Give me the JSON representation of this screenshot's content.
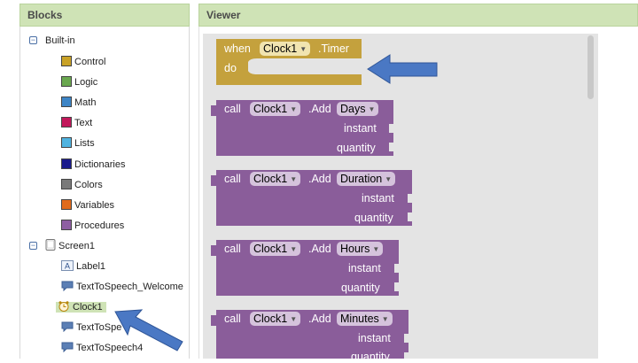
{
  "panels": {
    "blocks_title": "Blocks",
    "viewer_title": "Viewer"
  },
  "tree": {
    "builtin": {
      "label": "Built-in",
      "items": [
        {
          "label": "Control",
          "color": "#c9a227"
        },
        {
          "label": "Logic",
          "color": "#6aa84f"
        },
        {
          "label": "Math",
          "color": "#3d85c6"
        },
        {
          "label": "Text",
          "color": "#c2185b"
        },
        {
          "label": "Lists",
          "color": "#4fb3e0"
        },
        {
          "label": "Dictionaries",
          "color": "#1a1a8c"
        },
        {
          "label": "Colors",
          "color": "#7a7a7a"
        },
        {
          "label": "Variables",
          "color": "#e06a1b"
        },
        {
          "label": "Procedures",
          "color": "#8e5ea2"
        }
      ]
    },
    "screen": {
      "label": "Screen1",
      "items": [
        {
          "label": "Label1",
          "icon": "label-icon"
        },
        {
          "label": "TextToSpeech_Welcome",
          "icon": "tts-icon"
        },
        {
          "label": "Clock1",
          "icon": "clock-icon",
          "selected": true
        },
        {
          "label": "TextToSpe",
          "icon": "tts-icon"
        },
        {
          "label": "TextToSpeech4",
          "icon": "tts-icon"
        }
      ]
    }
  },
  "event_block": {
    "when": "when",
    "component": "Clock1",
    "event": ".Timer",
    "do": "do",
    "color": "#c4a13d"
  },
  "call_blocks": [
    {
      "call": "call",
      "component": "Clock1",
      "method": ".Add",
      "unit": "Days",
      "param1": "instant",
      "param2": "quantity"
    },
    {
      "call": "call",
      "component": "Clock1",
      "method": ".Add",
      "unit": "Duration",
      "param1": "instant",
      "param2": "quantity"
    },
    {
      "call": "call",
      "component": "Clock1",
      "method": ".Add",
      "unit": "Hours",
      "param1": "instant",
      "param2": "quantity"
    },
    {
      "call": "call",
      "component": "Clock1",
      "method": ".Add",
      "unit": "Minutes",
      "param1": "instant",
      "param2": "quantity"
    }
  ],
  "colors": {
    "procedure_purple": "#8a5d9a",
    "annotation_arrow": "#4a78c4"
  }
}
